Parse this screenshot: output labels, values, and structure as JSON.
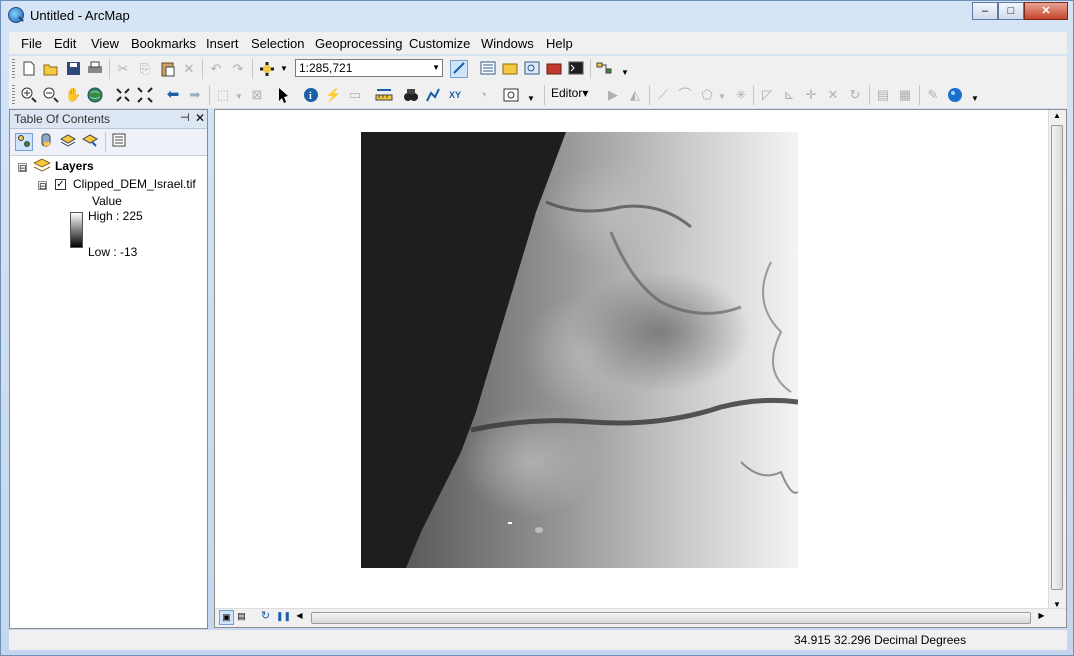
{
  "window": {
    "title": "Untitled - ArcMap",
    "minimize_glyph": "–",
    "maximize_glyph": "□",
    "close_glyph": "✕"
  },
  "menu": [
    "File",
    "Edit",
    "View",
    "Bookmarks",
    "Insert",
    "Selection",
    "Geoprocessing",
    "Customize",
    "Windows",
    "Help"
  ],
  "standard_toolbar": {
    "scale_value": "1:285,721",
    "icons": [
      "new-document-icon",
      "open-icon",
      "save-icon",
      "print-icon",
      "cut-icon",
      "copy-icon",
      "paste-icon",
      "delete-icon",
      "undo-icon",
      "redo-icon",
      "add-data-icon"
    ]
  },
  "tools_toolbar": {
    "editor_label": "Editor",
    "editor_arrow": "▾"
  },
  "toc": {
    "title": "Table Of Contents",
    "pin_glyph": "⬚",
    "close_glyph": "✕",
    "layers_label": "Layers",
    "layer_name": "Clipped_DEM_Israel.tif",
    "layer_checked": true,
    "legend_heading": "Value",
    "legend_high": "High : 225",
    "legend_low": "Low : -13",
    "expand_glyph": "⊟"
  },
  "status": {
    "coordinates": "34.915  32.296 Decimal Degrees"
  },
  "colors": {
    "titlebar": "#c4d7ee",
    "panel_bg": "#f0f0f0",
    "raster_dark": "#1e1e1e",
    "raster_light": "#f2f2f2"
  }
}
